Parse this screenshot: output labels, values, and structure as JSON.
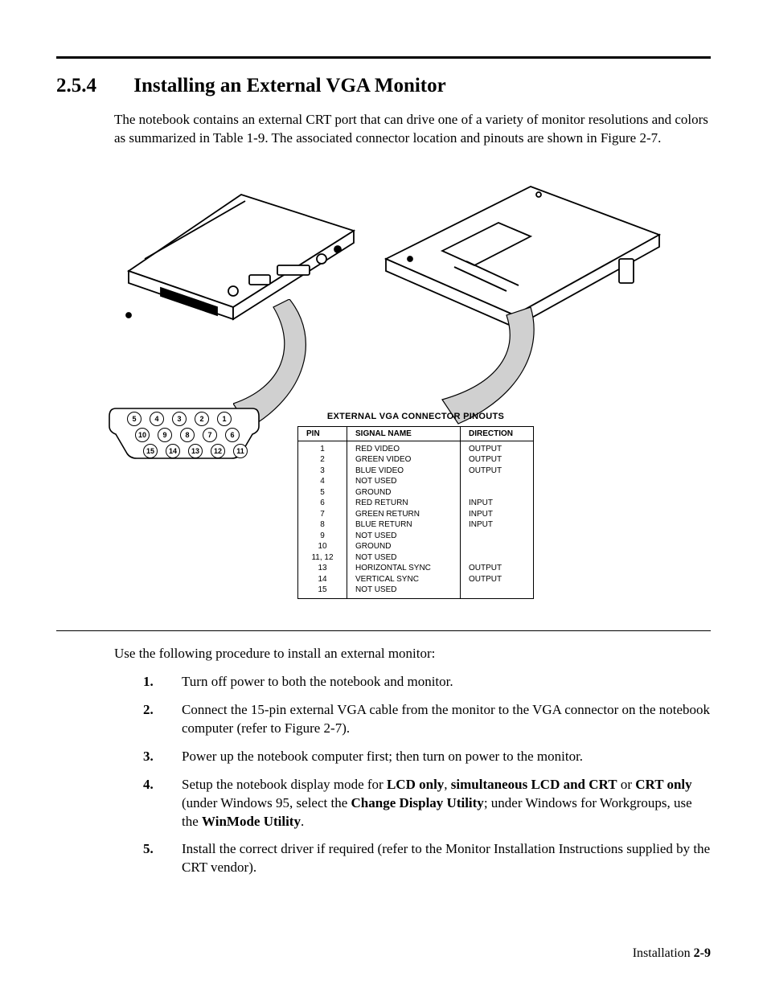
{
  "section": {
    "number": "2.5.4",
    "title": "Installing an External VGA Monitor"
  },
  "intro": "The notebook contains an external CRT port that can drive one of  a variety of monitor resolutions and colors as summarized in Table 1-9. The associated connector location and pinouts are shown in Figure 2-7.",
  "connector": {
    "row1": [
      "5",
      "4",
      "3",
      "2",
      "1"
    ],
    "row2": [
      "10",
      "9",
      "8",
      "7",
      "6"
    ],
    "row3": [
      "15",
      "14",
      "13",
      "12",
      "11"
    ]
  },
  "pinout": {
    "title": "EXTERNAL VGA CONNECTOR PINOUTS",
    "headers": [
      "PIN",
      "SIGNAL NAME",
      "DIRECTION"
    ],
    "rows": [
      {
        "pin": "1",
        "signal": "RED VIDEO",
        "dir": "OUTPUT"
      },
      {
        "pin": "2",
        "signal": "GREEN VIDEO",
        "dir": "OUTPUT"
      },
      {
        "pin": "3",
        "signal": "BLUE VIDEO",
        "dir": "OUTPUT"
      },
      {
        "pin": "4",
        "signal": "NOT USED",
        "dir": ""
      },
      {
        "pin": "5",
        "signal": "GROUND",
        "dir": ""
      },
      {
        "pin": "6",
        "signal": "RED RETURN",
        "dir": "INPUT"
      },
      {
        "pin": "7",
        "signal": "GREEN RETURN",
        "dir": "INPUT"
      },
      {
        "pin": "8",
        "signal": "BLUE RETURN",
        "dir": "INPUT"
      },
      {
        "pin": "9",
        "signal": "NOT USED",
        "dir": ""
      },
      {
        "pin": "10",
        "signal": "GROUND",
        "dir": ""
      },
      {
        "pin": "11, 12",
        "signal": "NOT USED",
        "dir": ""
      },
      {
        "pin": "13",
        "signal": "HORIZONTAL SYNC",
        "dir": "OUTPUT"
      },
      {
        "pin": "14",
        "signal": "VERTICAL SYNC",
        "dir": "OUTPUT"
      },
      {
        "pin": "15",
        "signal": "NOT USED",
        "dir": ""
      }
    ]
  },
  "procedure": {
    "intro": "Use the following procedure to install an external monitor:",
    "steps": [
      {
        "num": "1.",
        "text": "Turn off power to both the notebook and monitor."
      },
      {
        "num": "2.",
        "text": "Connect the 15-pin external VGA cable from the monitor to the VGA connector on the notebook computer (refer to Figure 2-7)."
      },
      {
        "num": "3.",
        "text": "Power up the notebook computer first; then turn on power to the monitor."
      },
      {
        "num": "4.",
        "parts": [
          "Setup the notebook display mode for ",
          {
            "bold": "LCD only"
          },
          ", ",
          {
            "bold": "simultaneous LCD and CRT"
          },
          " or ",
          {
            "bold": "CRT only"
          },
          " (under Windows 95, select the ",
          {
            "bold": "Change Display Utility"
          },
          "; under Windows for Workgroups, use the ",
          {
            "bold": "WinMode Utility"
          },
          "."
        ]
      },
      {
        "num": "5.",
        "text": "Install the correct driver if required (refer to the Monitor Installation Instructions supplied by the CRT vendor)."
      }
    ]
  },
  "footer": {
    "label": "Installation",
    "page": "2-9"
  }
}
